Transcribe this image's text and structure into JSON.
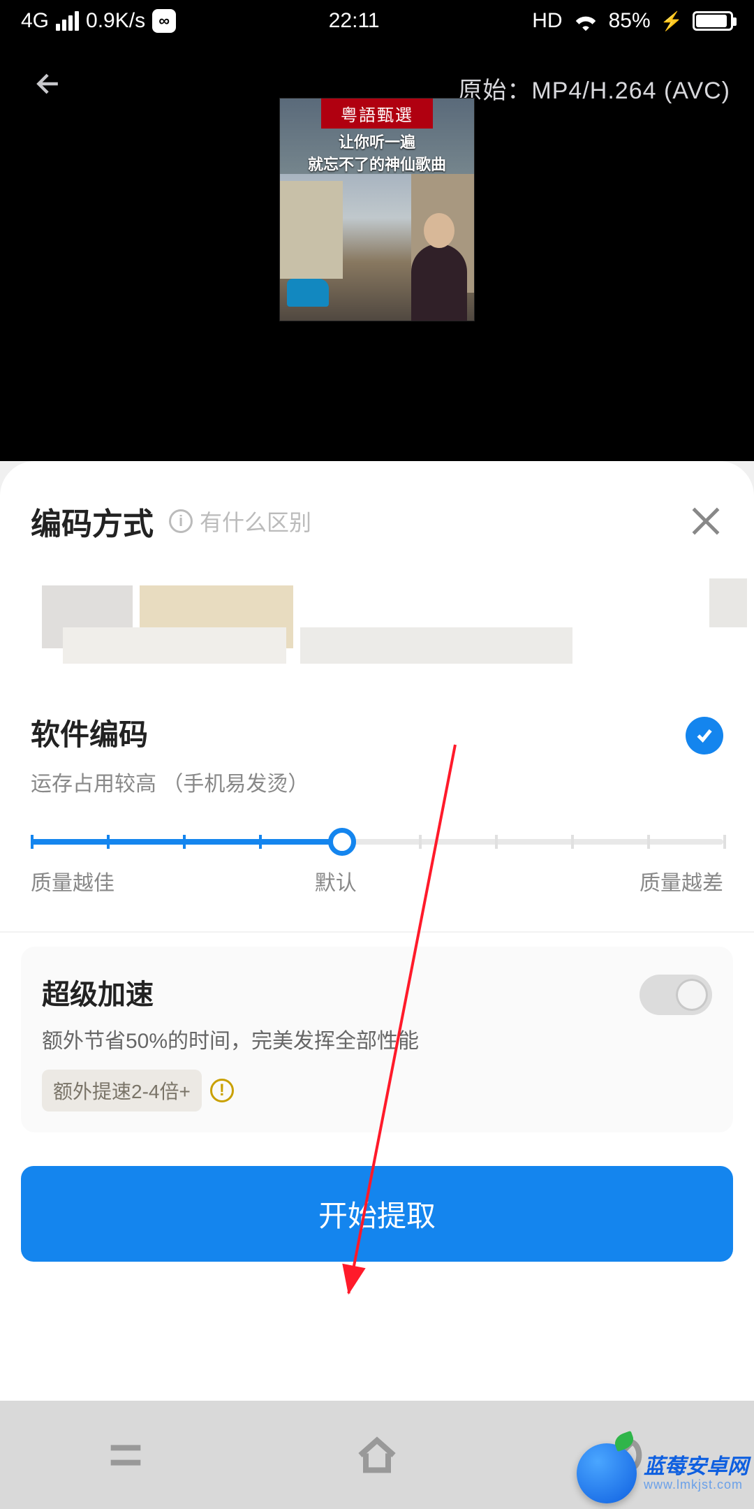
{
  "status": {
    "network": "4G",
    "speed": "0.9K/s",
    "time": "22:11",
    "hd": "HD",
    "battery_pct": "85%"
  },
  "video": {
    "original_label": "原始：MP4/H.264 (AVC)",
    "thumb_banner": "粤語甄選",
    "thumb_line1": "让你听一遍",
    "thumb_line2": "就忘不了的神仙歌曲"
  },
  "sheet": {
    "title": "编码方式",
    "info_link": "有什么区别"
  },
  "software_encode": {
    "title": "软件编码",
    "subtitle": "运存占用较高 （手机易发烫）"
  },
  "slider": {
    "left": "质量越佳",
    "mid": "默认",
    "right": "质量越差"
  },
  "accel": {
    "title": "超级加速",
    "subtitle": "额外节省50%的时间，完美发挥全部性能",
    "badge": "额外提速2-4倍+"
  },
  "cta": "开始提取",
  "watermark": {
    "line1": "蓝莓安卓网",
    "line2": "www.lmkjst.com"
  }
}
